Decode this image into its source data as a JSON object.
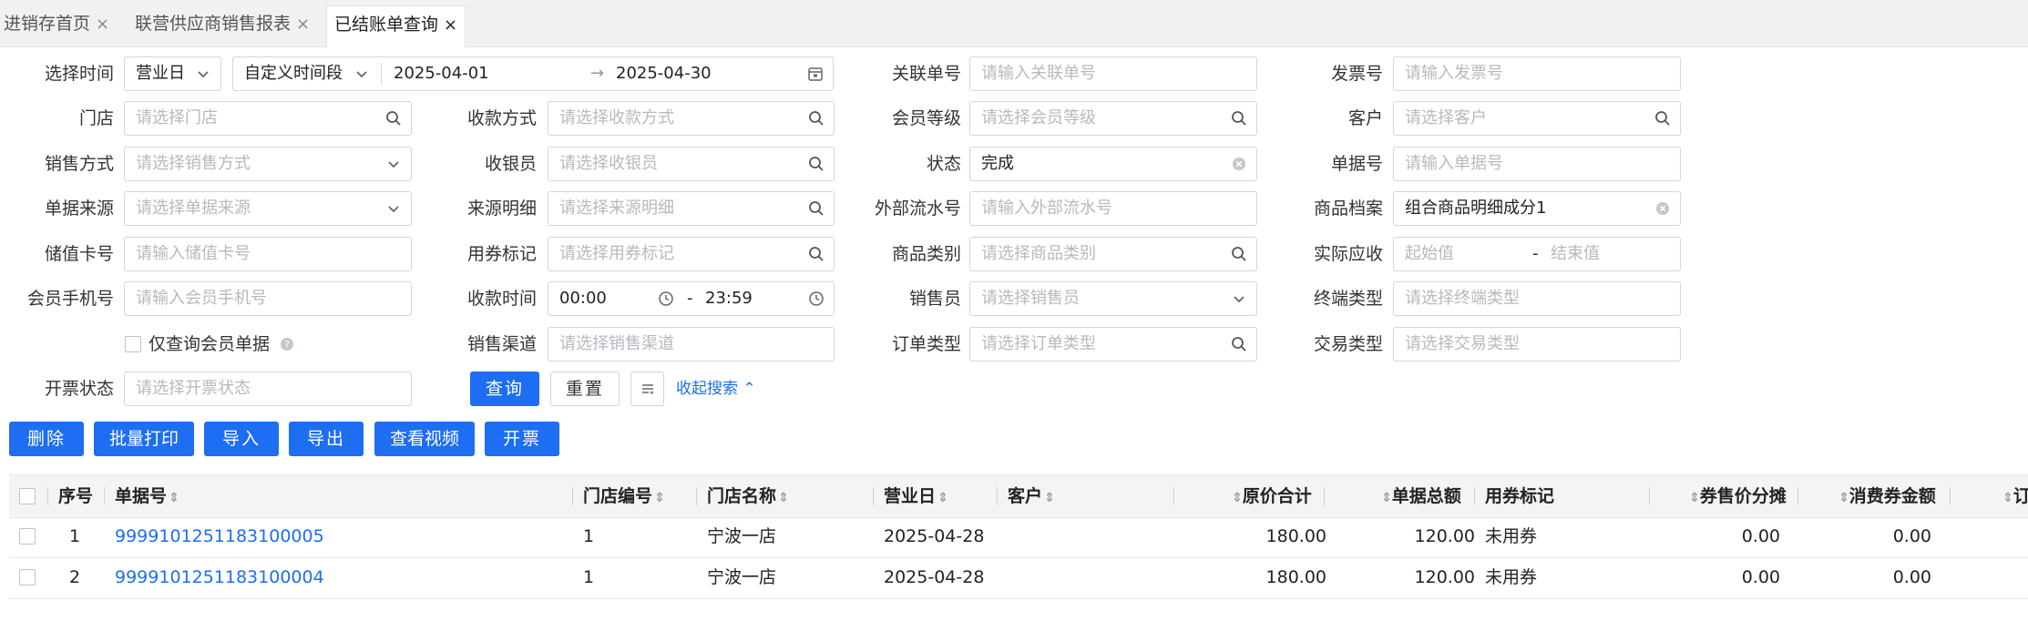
{
  "tabs": [
    {
      "label": "进销存首页",
      "close": "×"
    },
    {
      "label": "联营供应商销售报表",
      "close": "×"
    },
    {
      "label": "已结账单查询",
      "close": "×"
    }
  ],
  "filters": {
    "time_label": "选择时间",
    "time_type": "营业日",
    "time_range_type": "自定义时间段",
    "date_start": "2025-04-01",
    "date_arrow": "→",
    "date_end": "2025-04-30",
    "related_no_label": "关联单号",
    "related_no_ph": "请输入关联单号",
    "invoice_no_label": "发票号",
    "invoice_no_ph": "请输入发票号",
    "store_label": "门店",
    "store_ph": "请选择门店",
    "pay_method_label": "收款方式",
    "pay_method_ph": "请选择收款方式",
    "member_level_label": "会员等级",
    "member_level_ph": "请选择会员等级",
    "customer_label": "客户",
    "customer_ph": "请选择客户",
    "sale_method_label": "销售方式",
    "sale_method_ph": "请选择销售方式",
    "cashier_label": "收银员",
    "cashier_ph": "请选择收银员",
    "status_label": "状态",
    "status_value": "完成",
    "doc_no_label": "单据号",
    "doc_no_ph": "请输入单据号",
    "doc_source_label": "单据来源",
    "doc_source_ph": "请选择单据来源",
    "source_detail_label": "来源明细",
    "source_detail_ph": "请选择来源明细",
    "ext_serial_label": "外部流水号",
    "ext_serial_ph": "请输入外部流水号",
    "product_file_label": "商品档案",
    "product_file_value": "组合商品明细成分1",
    "stored_card_label": "储值卡号",
    "stored_card_ph": "请输入储值卡号",
    "coupon_mark_label": "用券标记",
    "coupon_mark_ph": "请选择用券标记",
    "product_cat_label": "商品类别",
    "product_cat_ph": "请选择商品类别",
    "actual_recv_label": "实际应收",
    "actual_recv_min_ph": "起始值",
    "actual_recv_dash": "-",
    "actual_recv_max_ph": "结束值",
    "member_phone_label": "会员手机号",
    "member_phone_ph": "请输入会员手机号",
    "recv_time_label": "收款时间",
    "recv_time_start": "00:00",
    "recv_time_dash": "-",
    "recv_time_end": "23:59",
    "salesperson_label": "销售员",
    "salesperson_ph": "请选择销售员",
    "terminal_label": "终端类型",
    "terminal_ph": "请选择终端类型",
    "member_only_label": "仅查询会员单据",
    "channel_label": "销售渠道",
    "channel_ph": "请选择销售渠道",
    "order_type_label": "订单类型",
    "order_type_ph": "请选择订单类型",
    "trade_type_label": "交易类型",
    "trade_type_ph": "请选择交易类型",
    "invoice_status_label": "开票状态",
    "invoice_status_ph": "请选择开票状态",
    "query_btn": "查询",
    "reset_btn": "重置",
    "collapse_link": "收起搜索"
  },
  "toolbar": {
    "delete": "删除",
    "batch_print": "批量打印",
    "import": "导入",
    "export": "导出",
    "view_video": "查看视频",
    "invoice": "开票"
  },
  "table": {
    "headers": {
      "seq": "序号",
      "doc_no": "单据号",
      "store_code": "门店编号",
      "store_name": "门店名称",
      "biz_date": "营业日",
      "customer": "客户",
      "orig_total": "原价合计",
      "doc_total": "单据总额",
      "coupon_mark": "用券标记",
      "coupon_share": "券售价分摊",
      "consume_coupon": "消费券金额",
      "more": "订"
    },
    "rows": [
      {
        "seq": "1",
        "doc_no": "9999101251183100005",
        "store_code": "1",
        "store_name": "宁波一店",
        "biz_date": "2025-04-28",
        "customer": "",
        "orig_total": "180.00",
        "doc_total": "120.00",
        "coupon_mark": "未用券",
        "coupon_share": "0.00",
        "consume_coupon": "0.00"
      },
      {
        "seq": "2",
        "doc_no": "9999101251183100004",
        "store_code": "1",
        "store_name": "宁波一店",
        "biz_date": "2025-04-28",
        "customer": "",
        "orig_total": "180.00",
        "doc_total": "120.00",
        "coupon_mark": "未用券",
        "coupon_share": "0.00",
        "consume_coupon": "0.00"
      }
    ]
  },
  "colors": {
    "accent": "#1d6ef2",
    "border": "#d3d6db",
    "placeholder": "#b6b9bf"
  }
}
